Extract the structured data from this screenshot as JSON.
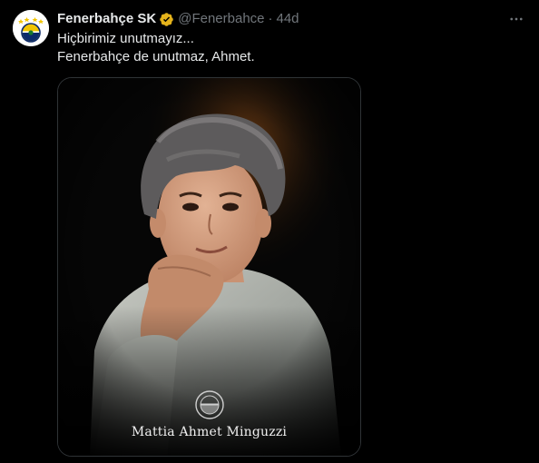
{
  "tweet": {
    "display_name": "Fenerbahçe SK",
    "handle": "@Fenerbahce",
    "separator": "·",
    "time": "44d",
    "text": "Hiçbirimiz unutmayız...\nFenerbahçe de unutmaz, Ahmet.",
    "more_icon": "more-horizontal-icon",
    "verified_icon": "verified-badge-icon",
    "verified_color": "#e5b31b"
  },
  "media": {
    "caption": "Mattia Ahmet Minguzzi",
    "description_icon": "fenerbahce-crest-icon"
  },
  "colors": {
    "background": "#000000",
    "primary_text": "#e7e9ea",
    "secondary_text": "#71767b",
    "border": "#2f3336"
  }
}
